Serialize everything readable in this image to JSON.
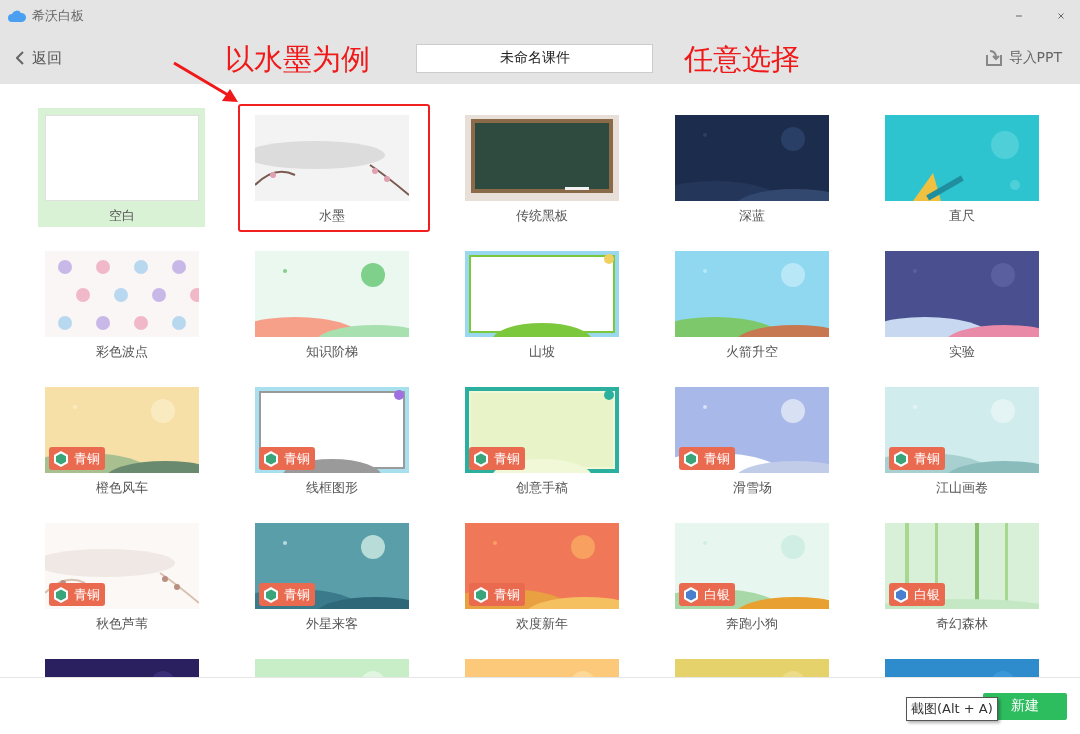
{
  "window": {
    "title": "希沃白板"
  },
  "toolbar": {
    "back": "返回",
    "course_title": "未命名课件",
    "import": "导入PPT"
  },
  "annotations": [
    {
      "kind": "arrow"
    },
    {
      "kind": "text",
      "text": "以水墨为例"
    },
    {
      "kind": "text",
      "text": "任意选择"
    }
  ],
  "templates": [
    {
      "name": "空白",
      "kind": "blank",
      "selected": true,
      "highlighted": false
    },
    {
      "name": "水墨",
      "kind": "picture",
      "selected": false,
      "highlighted": true
    },
    {
      "name": "传统黑板",
      "kind": "picture",
      "selected": false,
      "highlighted": false
    },
    {
      "name": "深蓝",
      "kind": "picture",
      "selected": false,
      "highlighted": false
    },
    {
      "name": "直尺",
      "kind": "picture",
      "selected": false,
      "highlighted": false
    },
    {
      "name": "彩色波点",
      "kind": "picture",
      "selected": false,
      "highlighted": false
    },
    {
      "name": "知识阶梯",
      "kind": "picture",
      "selected": false,
      "highlighted": false
    },
    {
      "name": "山坡",
      "kind": "picture",
      "selected": false,
      "highlighted": false
    },
    {
      "name": "火箭升空",
      "kind": "picture",
      "selected": false,
      "highlighted": false
    },
    {
      "name": "实验",
      "kind": "picture",
      "selected": false,
      "highlighted": false
    },
    {
      "name": "橙色风车",
      "kind": "picture",
      "selected": false,
      "highlighted": false,
      "badge": {
        "label": "青铜",
        "color": "#3aa57a"
      }
    },
    {
      "name": "线框图形",
      "kind": "picture",
      "selected": false,
      "highlighted": false,
      "badge": {
        "label": "青铜",
        "color": "#3aa57a"
      }
    },
    {
      "name": "创意手稿",
      "kind": "picture",
      "selected": false,
      "highlighted": false,
      "badge": {
        "label": "青铜",
        "color": "#3aa57a"
      }
    },
    {
      "name": "滑雪场",
      "kind": "picture",
      "selected": false,
      "highlighted": false,
      "badge": {
        "label": "青铜",
        "color": "#3aa57a"
      }
    },
    {
      "name": "江山画卷",
      "kind": "picture",
      "selected": false,
      "highlighted": false,
      "badge": {
        "label": "青铜",
        "color": "#3aa57a"
      }
    },
    {
      "name": "秋色芦苇",
      "kind": "picture",
      "selected": false,
      "highlighted": false,
      "badge": {
        "label": "青铜",
        "color": "#3aa57a"
      }
    },
    {
      "name": "外星来客",
      "kind": "picture",
      "selected": false,
      "highlighted": false,
      "badge": {
        "label": "青铜",
        "color": "#3aa57a"
      }
    },
    {
      "name": "欢度新年",
      "kind": "picture",
      "selected": false,
      "highlighted": false,
      "badge": {
        "label": "青铜",
        "color": "#3aa57a"
      }
    },
    {
      "name": "奔跑小狗",
      "kind": "picture",
      "selected": false,
      "highlighted": false,
      "badge": {
        "label": "白银",
        "color": "#4a7fd0"
      }
    },
    {
      "name": "奇幻森林",
      "kind": "picture",
      "selected": false,
      "highlighted": false,
      "badge": {
        "label": "白银",
        "color": "#4a7fd0"
      }
    },
    {
      "kind": "picture",
      "selected": false
    },
    {
      "kind": "picture",
      "selected": false
    },
    {
      "kind": "picture",
      "selected": false
    },
    {
      "kind": "picture",
      "selected": false
    },
    {
      "kind": "picture",
      "selected": false
    }
  ],
  "footer": {
    "create_button": "新建",
    "tooltip": "截图(Alt + A)"
  }
}
